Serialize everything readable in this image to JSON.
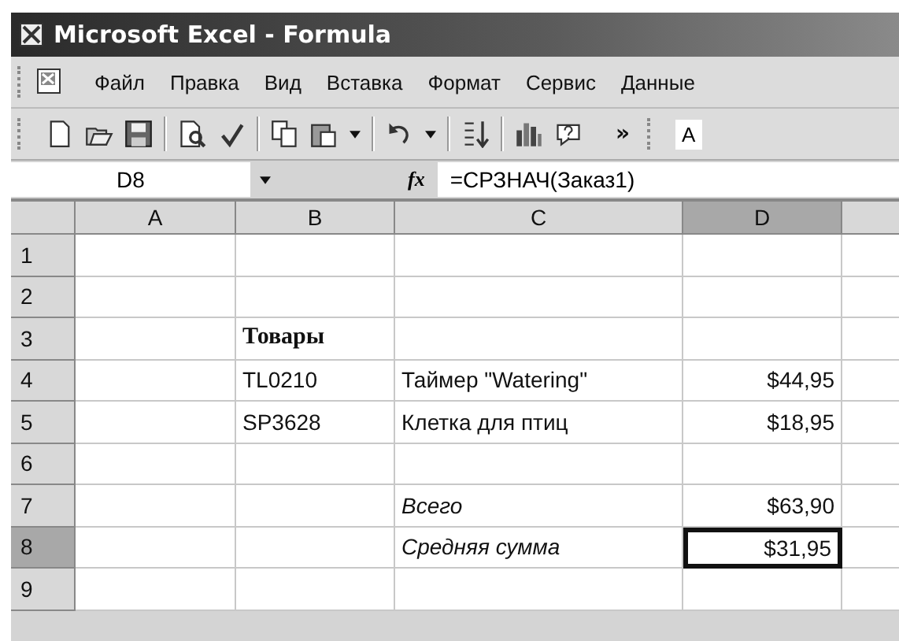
{
  "window": {
    "title": "Microsoft Excel - Formula"
  },
  "menu": [
    "Файл",
    "Правка",
    "Вид",
    "Вставка",
    "Формат",
    "Сервис",
    "Данные"
  ],
  "toolbar": {
    "overflow": "»",
    "next_label": "A"
  },
  "formula_bar": {
    "name_box": "D8",
    "fx": "fx",
    "formula": "=СРЗНАЧ(Заказ1)"
  },
  "columns": [
    {
      "label": "A",
      "selected": false
    },
    {
      "label": "B",
      "selected": false
    },
    {
      "label": "C",
      "selected": false
    },
    {
      "label": "D",
      "selected": true
    }
  ],
  "rows": [
    {
      "label": "1",
      "selected": false,
      "cells": [
        {
          "kind": "empty",
          "selected": false
        },
        {
          "kind": "empty",
          "selected": false
        },
        {
          "kind": "empty",
          "selected": false
        },
        {
          "kind": "empty",
          "selected": false
        }
      ]
    },
    {
      "label": "2",
      "selected": false,
      "cells": [
        {
          "kind": "empty",
          "selected": false
        },
        {
          "kind": "empty",
          "selected": false
        },
        {
          "kind": "empty",
          "selected": false
        },
        {
          "kind": "empty",
          "selected": false
        }
      ]
    },
    {
      "label": "3",
      "selected": false,
      "cells": [
        {
          "kind": "empty",
          "selected": false
        },
        {
          "kind": "heading",
          "text": "Товары",
          "selected": false
        },
        {
          "kind": "empty",
          "selected": false
        },
        {
          "kind": "empty",
          "selected": false
        }
      ]
    },
    {
      "label": "4",
      "selected": false,
      "cells": [
        {
          "kind": "empty",
          "selected": false
        },
        {
          "kind": "text",
          "text": "TL0210",
          "selected": false
        },
        {
          "kind": "text",
          "text": "Таймер \"Watering\"",
          "selected": false
        },
        {
          "kind": "number",
          "text": "$44,95",
          "selected": false
        }
      ]
    },
    {
      "label": "5",
      "selected": false,
      "cells": [
        {
          "kind": "empty",
          "selected": false
        },
        {
          "kind": "text",
          "text": "SP3628",
          "selected": false
        },
        {
          "kind": "text",
          "text": "Клетка для птиц",
          "selected": false
        },
        {
          "kind": "number",
          "text": "$18,95",
          "selected": false
        }
      ]
    },
    {
      "label": "6",
      "selected": false,
      "cells": [
        {
          "kind": "empty",
          "selected": false
        },
        {
          "kind": "empty",
          "selected": false
        },
        {
          "kind": "empty",
          "selected": false
        },
        {
          "kind": "empty",
          "selected": false
        }
      ]
    },
    {
      "label": "7",
      "selected": false,
      "cells": [
        {
          "kind": "empty",
          "selected": false
        },
        {
          "kind": "empty",
          "selected": false
        },
        {
          "kind": "label",
          "text": "Всего",
          "selected": false
        },
        {
          "kind": "number",
          "text": "$63,90",
          "selected": false
        }
      ]
    },
    {
      "label": "8",
      "selected": true,
      "cells": [
        {
          "kind": "empty",
          "selected": false
        },
        {
          "kind": "empty",
          "selected": false
        },
        {
          "kind": "label",
          "text": "Средняя сумма",
          "selected": false
        },
        {
          "kind": "number",
          "text": "$31,95",
          "selected": true
        }
      ]
    },
    {
      "label": "9",
      "selected": false,
      "cells": [
        {
          "kind": "empty",
          "selected": false
        },
        {
          "kind": "empty",
          "selected": false
        },
        {
          "kind": "empty",
          "selected": false
        },
        {
          "kind": "empty",
          "selected": false
        }
      ]
    }
  ]
}
